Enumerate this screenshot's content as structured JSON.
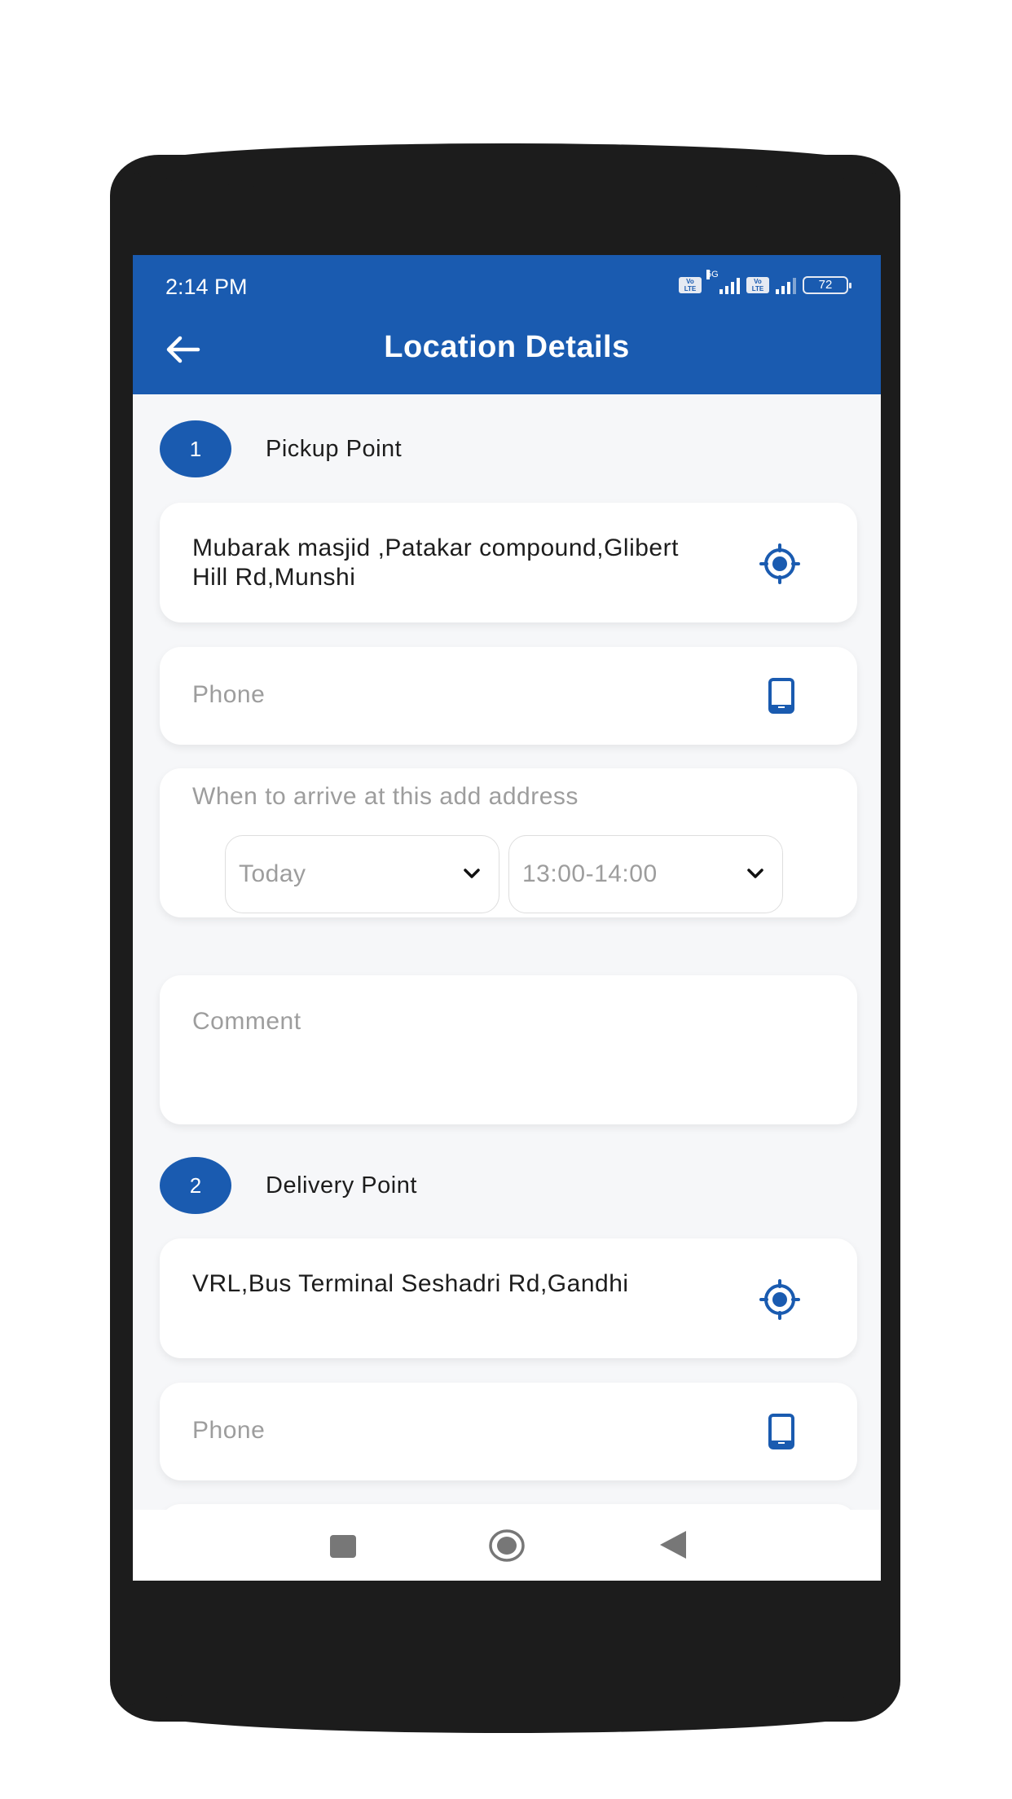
{
  "status_bar": {
    "time": "2:14 PM",
    "network_label": "5G",
    "volte_label": "Vo LTE",
    "battery_level": "72"
  },
  "header": {
    "title": "Location Details",
    "back_icon": "arrow-left-icon"
  },
  "pickup": {
    "step_number": "1",
    "title": "Pickup Point",
    "address": "Mubarak masjid ,Patakar compound,Glibert Hill Rd,Munshi",
    "address_icon": "gps-target-icon",
    "phone_placeholder": "Phone",
    "phone_icon": "smartphone-icon",
    "arrival_label": "When to arrive at this add address",
    "day_select": "Today",
    "time_select": "13:00-14:00",
    "comment_placeholder": "Comment"
  },
  "delivery": {
    "step_number": "2",
    "title": "Delivery Point",
    "address": "VRL,Bus Terminal Seshadri Rd,Gandhi",
    "address_icon": "gps-target-icon",
    "phone_placeholder": "Phone",
    "phone_icon": "smartphone-icon"
  },
  "nav_bar": {
    "buttons": [
      "recents",
      "home",
      "back"
    ]
  },
  "colors": {
    "primary": "#1a5bb0",
    "background": "#f6f7f9",
    "placeholder": "#9d9d9d",
    "text": "#1d1d1d"
  }
}
